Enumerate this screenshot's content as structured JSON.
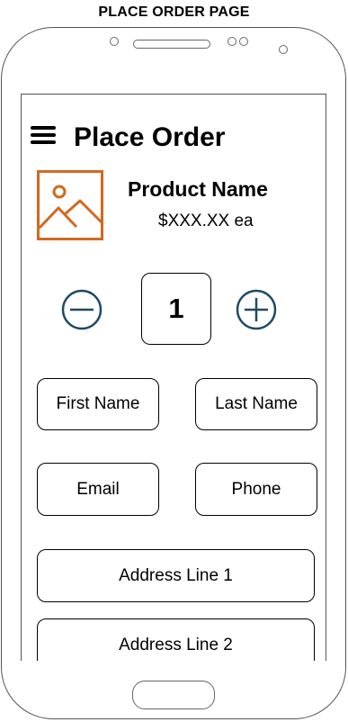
{
  "caption": "PLACE ORDER PAGE",
  "header": {
    "title": "Place Order",
    "menu_icon": "hamburger-menu-icon"
  },
  "product": {
    "image_icon": "image-placeholder-icon",
    "name": "Product Name",
    "price": "$XXX.XX ea",
    "image_color": "#D2691E"
  },
  "quantity": {
    "value": "1",
    "decrement_icon": "minus-circle-icon",
    "increment_icon": "plus-circle-icon",
    "icon_color": "#1F4A66"
  },
  "form": {
    "first_name": "First Name",
    "last_name": "Last Name",
    "email": "Email",
    "phone": "Phone",
    "address_line_1": "Address Line 1",
    "address_line_2": "Address Line 2"
  }
}
